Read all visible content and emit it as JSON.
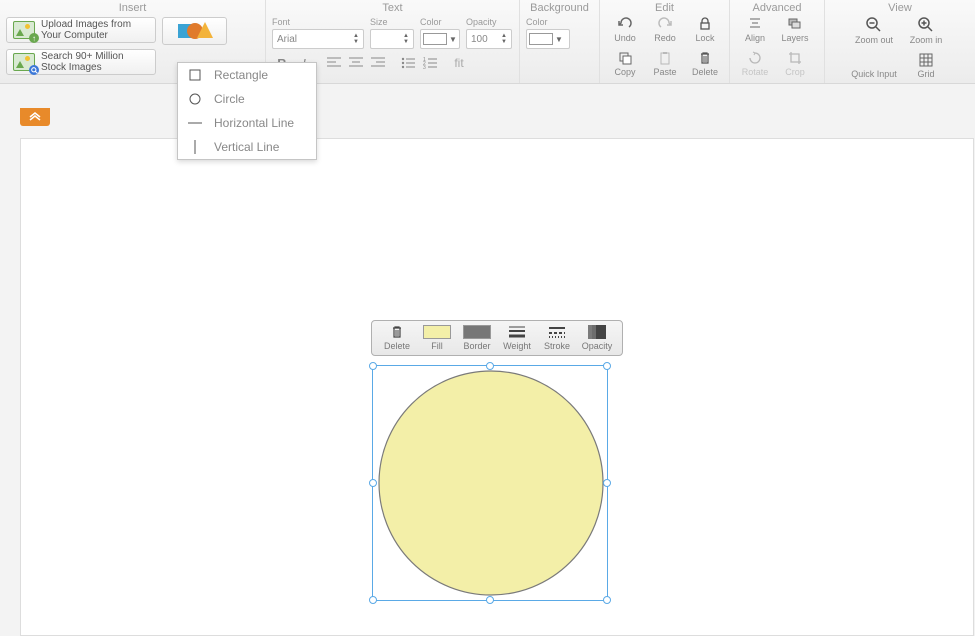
{
  "sections": {
    "insert": "Insert",
    "text": "Text",
    "background": "Background",
    "edit": "Edit",
    "advanced": "Advanced",
    "view": "View"
  },
  "insert": {
    "upload": "Upload Images from Your Computer",
    "search": "Search 90+ Million Stock Images"
  },
  "shape_menu": {
    "rectangle": "Rectangle",
    "circle": "Circle",
    "hline": "Horizontal Line",
    "vline": "Vertical Line"
  },
  "text": {
    "font_label": "Font",
    "font_value": "Arial",
    "size_label": "Size",
    "size_value": "",
    "color_label": "Color",
    "opacity_label": "Opacity",
    "opacity_value": "100",
    "fit": "fit"
  },
  "background": {
    "color_label": "Color"
  },
  "edit": {
    "undo": "Undo",
    "redo": "Redo",
    "lock": "Lock",
    "copy": "Copy",
    "paste": "Paste",
    "delete": "Delete"
  },
  "advanced": {
    "align": "Align",
    "layers": "Layers",
    "rotate": "Rotate",
    "crop": "Crop"
  },
  "view": {
    "zoom_out": "Zoom out",
    "zoom_in": "Zoom in",
    "quick_input": "Quick Input",
    "grid": "Grid"
  },
  "ctx": {
    "delete": "Delete",
    "fill": "Fill",
    "border": "Border",
    "weight": "Weight",
    "stroke": "Stroke",
    "opacity": "Opacity"
  },
  "colors": {
    "shape_fill": "#f3efa8",
    "shape_border": "#7a7a7a",
    "ctx_fill": "#f3efa8",
    "ctx_border": "#777777",
    "text_color": "#ffffff",
    "bg_color": "#ffffff"
  }
}
